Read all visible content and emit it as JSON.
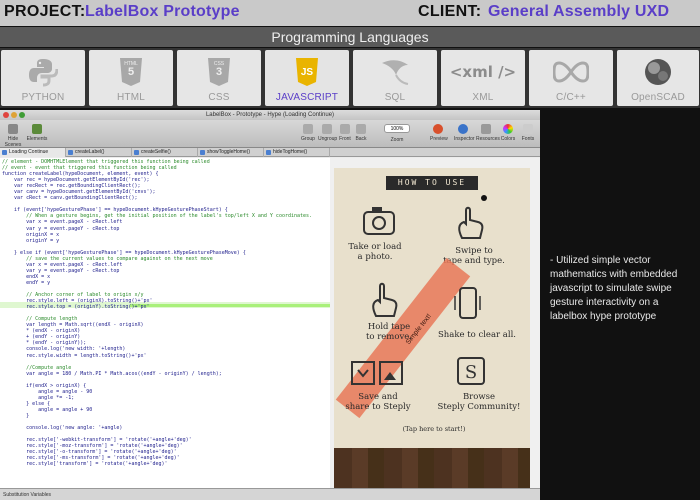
{
  "header": {
    "project_label": "PROJECT:",
    "project_value": "LabelBox Prototype",
    "client_label": "CLIENT:",
    "client_value": "General Assembly UXD"
  },
  "section_title": "Programming Languages",
  "languages": [
    {
      "label": "PYTHON",
      "icon": "python-icon",
      "active": false
    },
    {
      "label": "HTML",
      "icon": "html5-icon",
      "active": false
    },
    {
      "label": "CSS",
      "icon": "css3-icon",
      "active": false
    },
    {
      "label": "JAVASCRIPT",
      "icon": "js-icon",
      "active": true
    },
    {
      "label": "SQL",
      "icon": "sql-icon",
      "active": false
    },
    {
      "label": "XML",
      "icon": "xml-icon",
      "icon_text": "<xml />",
      "active": false
    },
    {
      "label": "C/C++",
      "icon": "cpp-icon",
      "active": false
    },
    {
      "label": "OpenSCAD",
      "icon": "openscad-icon",
      "active": false
    }
  ],
  "accent_color": "#5a3ec8",
  "window": {
    "title": "LabelBox - Prototype - Hype (Loading Continue)",
    "toolbar": {
      "hide_scenes": "Hide Scenes",
      "elements": "Elements",
      "group": "Group",
      "ungroup": "Ungroup",
      "front": "Front",
      "back": "Back",
      "zoom_label": "Zoom",
      "zoom_value": "100%",
      "preview": "Preview",
      "inspector": "Inspector",
      "resources": "Resources",
      "colors": "Colors",
      "fonts": "Fonts"
    },
    "tabs": [
      "Loading Continue",
      "createLabel()",
      "createSelfie()",
      "showToggleHome()",
      "hideTogHome()"
    ],
    "code_lines": [
      {
        "t": "// element - DOMHTMLElement that triggered this function being called",
        "c": "cmt"
      },
      {
        "t": "// event - event that triggered this function being called",
        "c": "cmt"
      },
      {
        "t": "function createLabel(hypeDocument, element, event) {",
        "c": ""
      },
      {
        "t": "    var rec = hypeDocument.getElementById('rec');",
        "c": ""
      },
      {
        "t": "    var recRect = rec.getBoundingClientRect();",
        "c": ""
      },
      {
        "t": "    var canv = hypeDocument.getElementById('cnvs');",
        "c": ""
      },
      {
        "t": "    var cRect = canv.getBoundingClientRect();",
        "c": ""
      },
      {
        "t": "",
        "c": ""
      },
      {
        "t": "    if (event['hypeGesturePhase'] == hypeDocument.kHypeGesturePhaseStart) {",
        "c": ""
      },
      {
        "t": "        // When a gesture begins, get the initial position of the label's top/left X and Y coordinates.",
        "c": "cmt"
      },
      {
        "t": "        var x = event.pageX - cRect.left",
        "c": ""
      },
      {
        "t": "        var y = event.pageY - cRect.top",
        "c": ""
      },
      {
        "t": "        originX = x",
        "c": ""
      },
      {
        "t": "        originY = y",
        "c": ""
      },
      {
        "t": "",
        "c": ""
      },
      {
        "t": "    } else if (event['hypeGesturePhase'] == hypeDocument.kHypeGesturePhaseMove) {",
        "c": ""
      },
      {
        "t": "        // save the current values to compare against on the next move",
        "c": "cmt"
      },
      {
        "t": "        var x = event.pageX - cRect.left",
        "c": ""
      },
      {
        "t": "        var y = event.pageY - cRect.top",
        "c": ""
      },
      {
        "t": "        endX = x",
        "c": ""
      },
      {
        "t": "        endY = y",
        "c": ""
      },
      {
        "t": "",
        "c": ""
      },
      {
        "t": "        // Anchor corner of label to origin x/y",
        "c": "cmt"
      },
      {
        "t": "        rec.style.left = (originX).toString()+'px'",
        "c": ""
      },
      {
        "t": "        rec.style.top = (originY).toString()+'px'",
        "c": ""
      },
      {
        "t": "",
        "c": ""
      },
      {
        "t": "        // Compute length",
        "c": "cmt"
      },
      {
        "t": "        var length = Math.sqrt((endX - originX)",
        "c": ""
      },
      {
        "t": "        * (endX - originX)",
        "c": ""
      },
      {
        "t": "        + (endY - originY)",
        "c": ""
      },
      {
        "t": "        * (endY - originY));",
        "c": ""
      },
      {
        "t": "        console.log('new width: '+length)",
        "c": ""
      },
      {
        "t": "        rec.style.width = length.toString()+'px'",
        "c": ""
      },
      {
        "t": "",
        "c": ""
      },
      {
        "t": "        //Compute angle",
        "c": "cmt"
      },
      {
        "t": "        var angle = 180 / Math.PI * Math.acos((endY - originY) / length);",
        "c": ""
      },
      {
        "t": "",
        "c": ""
      },
      {
        "t": "        if(endX > originX) {",
        "c": ""
      },
      {
        "t": "            angle = angle - 90",
        "c": ""
      },
      {
        "t": "            angle *= -1;",
        "c": ""
      },
      {
        "t": "        } else {",
        "c": ""
      },
      {
        "t": "            angle = angle + 90",
        "c": ""
      },
      {
        "t": "        }",
        "c": ""
      },
      {
        "t": "",
        "c": ""
      },
      {
        "t": "        console.log('new angle: '+angle)",
        "c": ""
      },
      {
        "t": "",
        "c": ""
      },
      {
        "t": "        rec.style['-webkit-transform'] = 'rotate('+angle+'deg)'",
        "c": ""
      },
      {
        "t": "        rec.style['-moz-transform'] = 'rotate('+angle+'deg)'",
        "c": ""
      },
      {
        "t": "        rec.style['-o-transform'] = 'rotate('+angle+'deg)'",
        "c": ""
      },
      {
        "t": "        rec.style['-ms-transform'] = 'rotate('+angle+'deg)'",
        "c": ""
      },
      {
        "t": "        rec.style['transform'] = 'rotate('+angle+'deg)'",
        "c": ""
      }
    ],
    "status": "Substitution Variables",
    "how_to": {
      "title": "HOW TO USE",
      "take_photo": "Take or load\na photo.",
      "swipe": "Swipe to\ntape and type.",
      "hold": "Hold tape\nto remove.",
      "shake": "Shake to clear all.",
      "save": "Save and\nshare to Steply",
      "browse": "Browse\nSteply Community!",
      "tap": "(Tap here to start!)",
      "tape_text": "Simple text!"
    }
  },
  "description": "- Utilized simple vector mathematics with embedded javascript to simulate swipe gesture interactivity on a labelbox hype prototype"
}
